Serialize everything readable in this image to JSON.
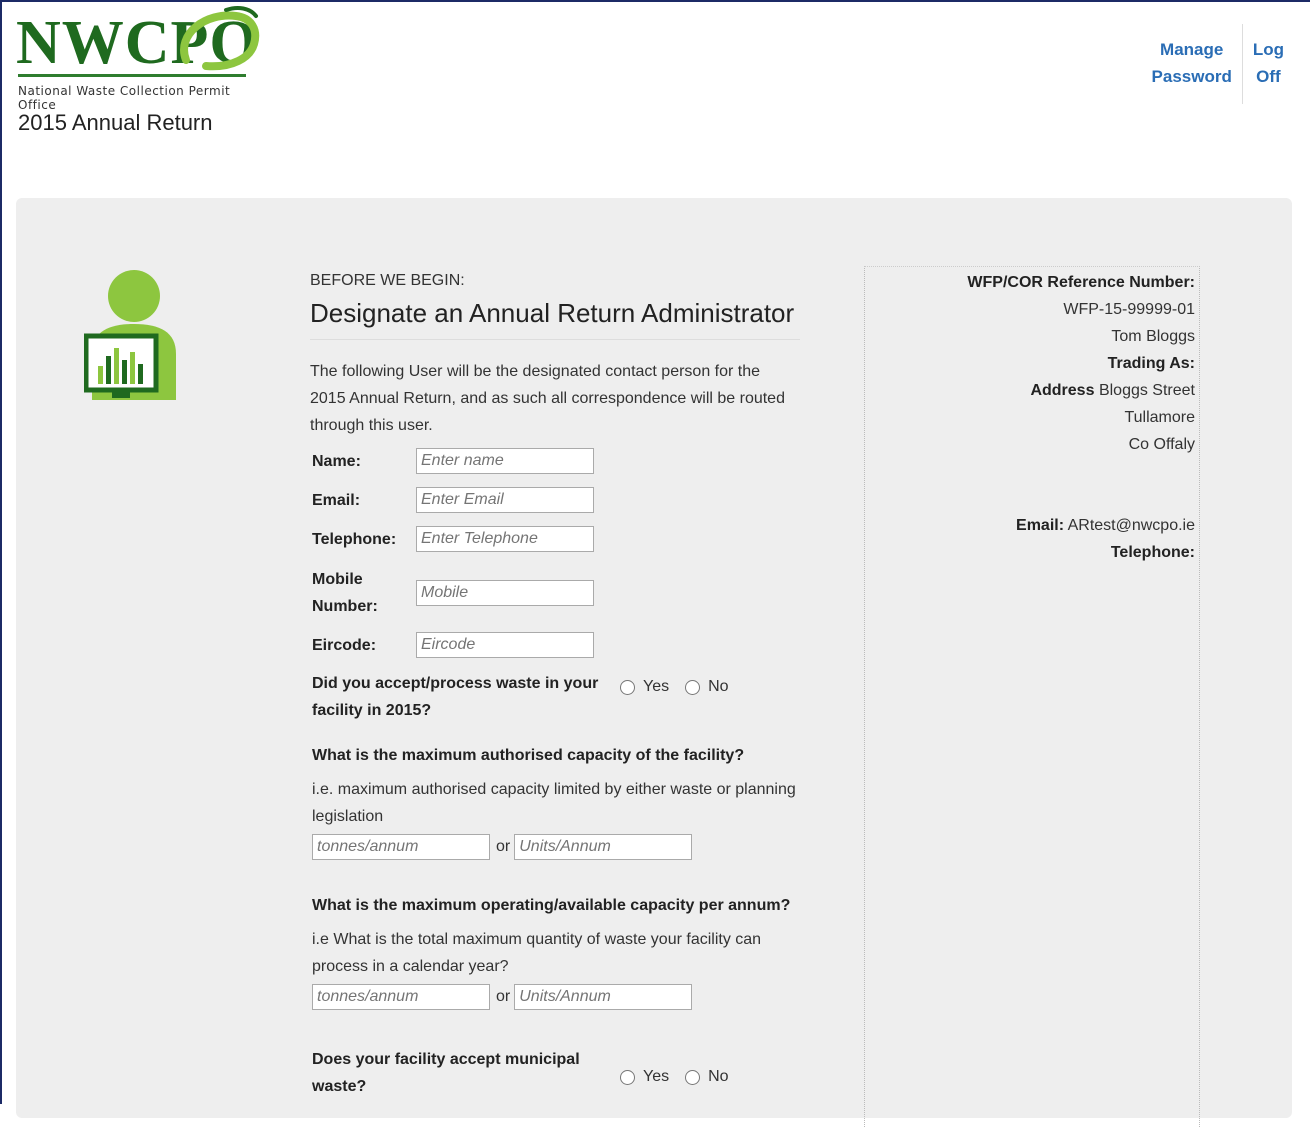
{
  "brand": {
    "logo_text": "NWCPO",
    "logo_subtitle": "National Waste Collection Permit Office",
    "page_title": "2015 Annual Return"
  },
  "nav": {
    "manage_password": "Manage Password",
    "manage_line1": "Manage",
    "manage_line2": "Password",
    "logoff_line1": "Log",
    "logoff_line2": "Off"
  },
  "form": {
    "kicker": "BEFORE WE BEGIN:",
    "heading": "Designate an Annual Return Administrator",
    "intro": "The following User will be the designated contact person for the 2015 Annual Return, and as such all correspondence will be routed through this user.",
    "fields": {
      "name": {
        "label": "Name:",
        "placeholder": "Enter name"
      },
      "email": {
        "label": "Email:",
        "placeholder": "Enter Email"
      },
      "telephone": {
        "label": "Telephone:",
        "placeholder": "Enter Telephone"
      },
      "mobile": {
        "label_line1": "Mobile",
        "label_line2": "Number:",
        "placeholder": "Mobile"
      },
      "eircode": {
        "label": "Eircode:",
        "placeholder": "Eircode"
      }
    },
    "q_accept": {
      "line1": "Did you accept/process waste in your",
      "line2": "facility in 2015?",
      "yes": "Yes",
      "no": "No"
    },
    "q_authorised": {
      "title": "What is the maximum authorised capacity of the facility?",
      "hint": "i.e. maximum authorised capacity limited by either waste or planning legislation",
      "tonnes_placeholder": "tonnes/annum",
      "or": "or",
      "units_placeholder": "Units/Annum"
    },
    "q_operating": {
      "title": "What is the maximum operating/available capacity per annum?",
      "hint": "i.e What is the total maximum quantity of waste your facility can process in a calendar year?",
      "tonnes_placeholder": "tonnes/annum",
      "or": "or",
      "units_placeholder": "Units/Annum"
    },
    "q_municipal": {
      "line1": "Does your facility accept municipal",
      "line2": "waste?",
      "yes": "Yes",
      "no": "No"
    }
  },
  "sidebar": {
    "ref_label": "WFP/COR Reference Number:",
    "ref_value": "WFP-15-99999-01",
    "holder": "Tom Bloggs",
    "trading_label": "Trading As:",
    "address_label": "Address",
    "address_line1": "Bloggs Street",
    "address_line2": "Tullamore",
    "address_line3": "Co Offaly",
    "email_label": "Email:",
    "email_value": "ARtest@nwcpo.ie",
    "telephone_label": "Telephone:"
  },
  "colors": {
    "brand_green": "#1f6a1f",
    "accent_green": "#8dc63f",
    "link_blue": "#2a6db5",
    "panel_bg": "#eeeeee",
    "frame_border": "#1c2a66"
  }
}
